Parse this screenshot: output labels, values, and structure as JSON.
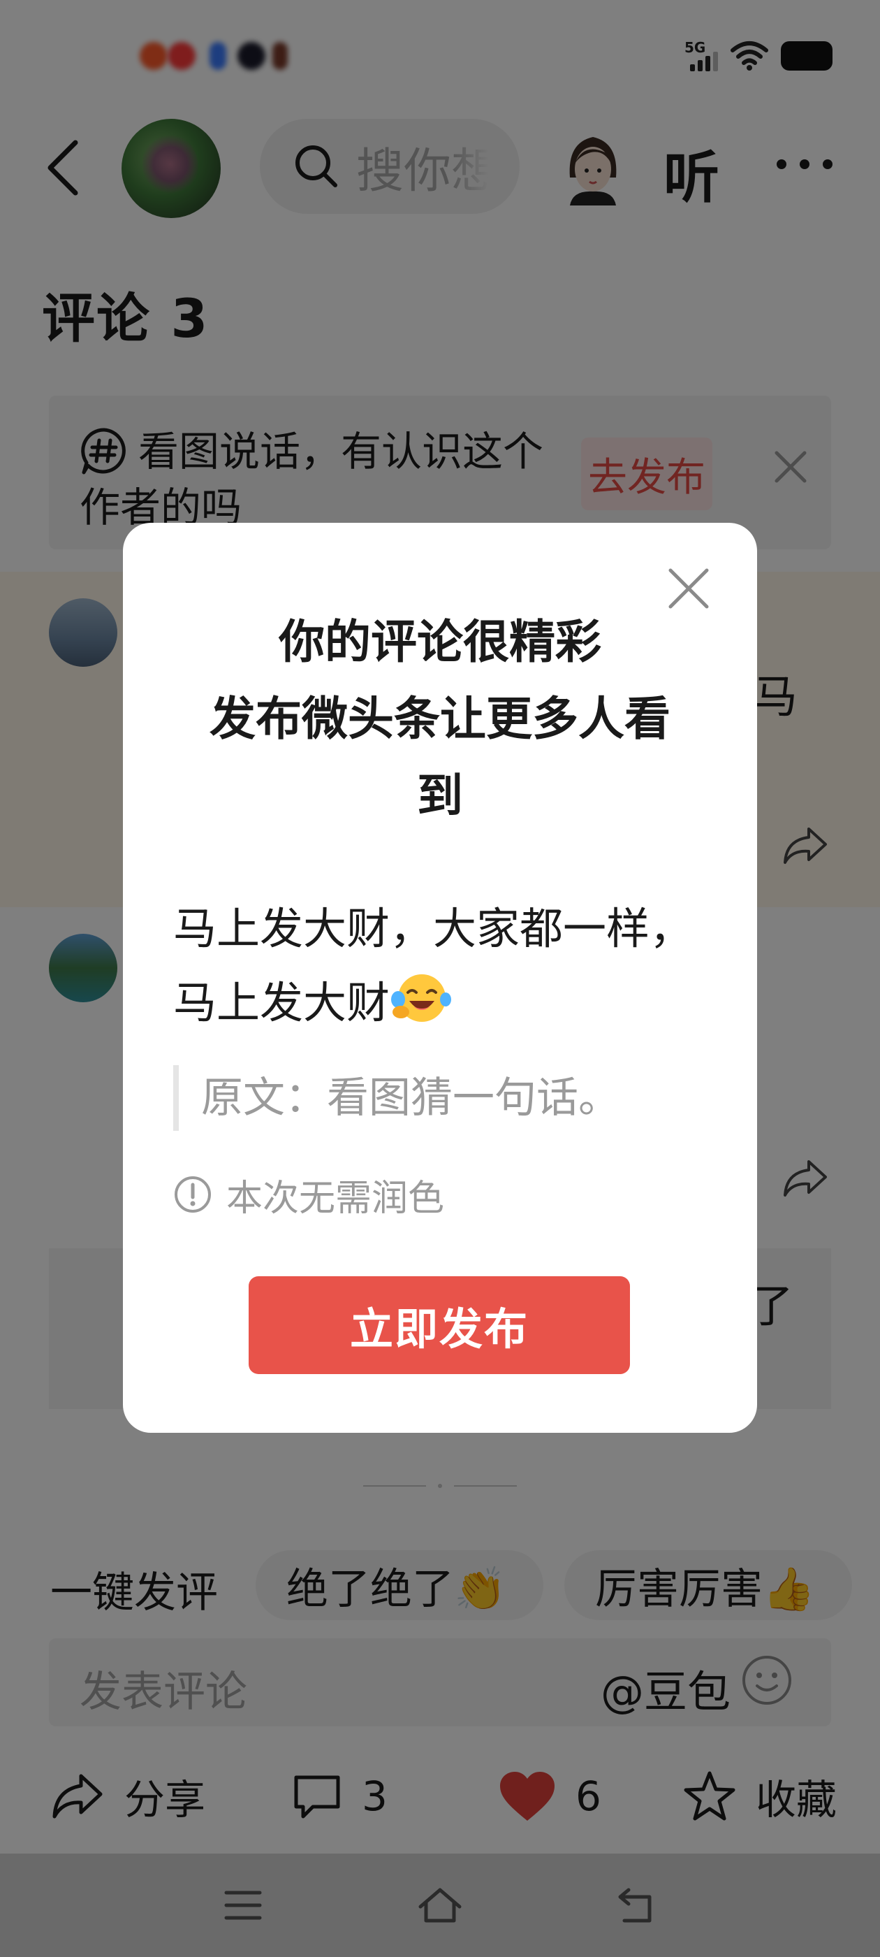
{
  "status_bar": {
    "network": "5G",
    "icons": [
      "signal-icon",
      "wifi-icon",
      "battery-icon"
    ]
  },
  "header": {
    "search_placeholder": "搜你想",
    "listen_label": "听",
    "icons": [
      "back-icon",
      "search-icon",
      "more-icon"
    ]
  },
  "comments_section": {
    "title": "评论 3",
    "hint_banner": {
      "text": "看图说话，有认识这个作者的吗",
      "publish_label": "去发布"
    },
    "partial_text_1": "马",
    "partial_text_2": "了"
  },
  "quick_reply": {
    "label": "一键发评",
    "chips": [
      "绝了绝了👏",
      "厉害厉害👍"
    ]
  },
  "comment_input": {
    "placeholder": "发表评论",
    "mention": "@豆包"
  },
  "action_bar": {
    "share_label": "分享",
    "comment_count": "3",
    "like_count": "6",
    "favorite_label": "收藏"
  },
  "dialog": {
    "title_lines": [
      "你的评论很精彩",
      "发布微头条让更多人看",
      "到"
    ],
    "comment_text_line1": "马上发大财，大家都一样，",
    "comment_text_line2": "马上发大财",
    "emoji": "laughing-crying-emoji",
    "original_text": "原文：看图猜一句话。",
    "note": "本次无需润色",
    "primary_button": "立即发布"
  },
  "colors": {
    "accent_red": "#e8534a",
    "like_red": "#e0403a",
    "mask": "rgba(0,0,0,0.5)"
  }
}
